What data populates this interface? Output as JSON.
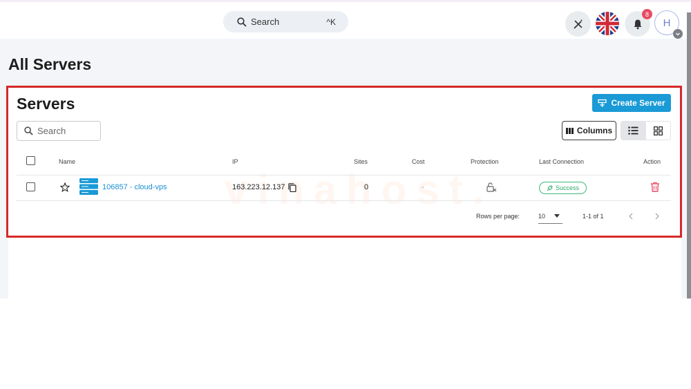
{
  "topbar": {
    "search_placeholder": "Search",
    "search_shortcut": "^K",
    "notification_count": "8",
    "avatar_initial": "H"
  },
  "page": {
    "title": "All Servers"
  },
  "card": {
    "title": "Servers",
    "create_label": "Create Server",
    "search_placeholder": "Search",
    "columns_label": "Columns"
  },
  "table": {
    "headers": [
      "Name",
      "IP",
      "Sites",
      "Cost",
      "Protection",
      "Last Connection",
      "Action"
    ],
    "rows": [
      {
        "name": "106857 - cloud-vps",
        "ip": "163.223.12.137",
        "sites": "0",
        "cost": "-",
        "status": "Success"
      }
    ]
  },
  "pagination": {
    "rows_per_page_label": "Rows per page:",
    "rows_per_page": "10",
    "range": "1-1 of 1"
  },
  "watermark": "vinahost.",
  "colors": {
    "accent": "#1a9ad6",
    "highlight_frame": "#d62828",
    "success": "#2fa866",
    "danger": "#e64c64"
  }
}
